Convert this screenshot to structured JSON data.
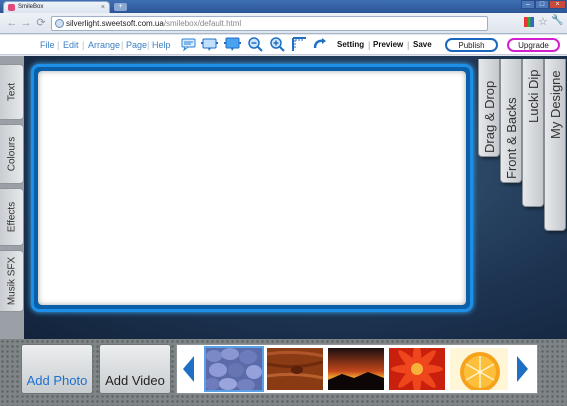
{
  "browser": {
    "tab_title": "SmileBox",
    "tab_close": "×",
    "new_tab": "+",
    "url_host": "silverlight.sweetsoft.com.ua",
    "url_path": "/smilebox/default.html",
    "win_min": "–",
    "win_max": "□",
    "win_close": "×"
  },
  "menu": {
    "file": "File",
    "edit": "Edit",
    "arrange": "Arrange",
    "page": "Page",
    "help": "Help",
    "setting": "Setting",
    "preview": "Preview",
    "save": "Save",
    "publish": "Publish",
    "upgrade": "Upgrade",
    "separator": "|"
  },
  "left_tabs": [
    "Text",
    "Colours",
    "Effects",
    "Musik SFX"
  ],
  "right_tabs": [
    "Drag & Drop",
    "Front & Backs",
    "Lucki Dip",
    "My Designe"
  ],
  "bottom": {
    "add_photo": "Add Photo",
    "add_video": "Add Video"
  },
  "colors": {
    "accent_blue": "#1a66c0",
    "upgrade_magenta": "#d21fd0",
    "frame_glow": "#1d8fe6"
  },
  "icons": [
    "back-icon",
    "forward-icon",
    "globe-icon",
    "page-icon",
    "star-icon",
    "wrench-icon",
    "speech-bubble-icon",
    "comment-icon",
    "screen-icon",
    "zoom-out-icon",
    "zoom-in-icon",
    "ruler-icon",
    "undo-icon"
  ]
}
